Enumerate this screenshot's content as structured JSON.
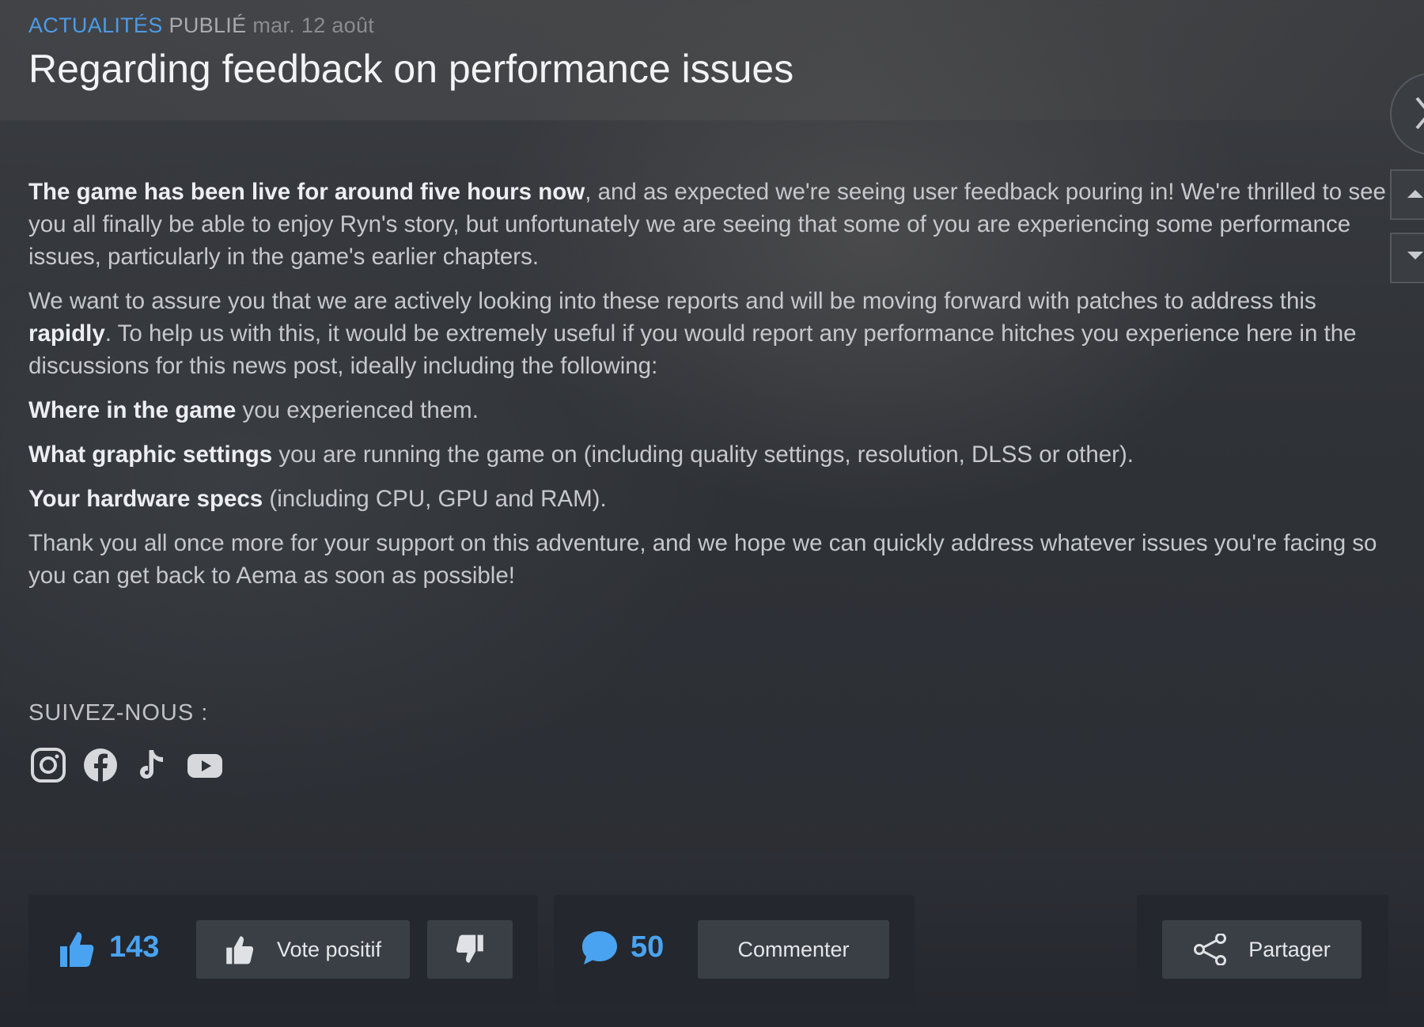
{
  "header": {
    "category": "ACTUALITÉS",
    "published_label": "PUBLIÉ",
    "date": "mar. 12 août",
    "title": "Regarding feedback on performance issues"
  },
  "article": {
    "p1_bold": "The game has been live for around five hours now",
    "p1_rest": ", and as expected we're seeing user feedback pouring in! We're thrilled to see you all finally be able to enjoy Ryn's story, but unfortunately we are seeing that some of you are experiencing some performance issues, particularly in the game's earlier chapters.",
    "p2_start": "We want to assure you that we are actively looking into these reports and will be moving forward with patches to address this ",
    "p2_bold": "rapidly",
    "p2_rest": ". To help us with this, it would be extremely useful if you would report any performance hitches you experience here in the discussions for this news post, ideally including the following:",
    "p3_bold": "Where in the game",
    "p3_rest": " you experienced them.",
    "p4_bold": "What graphic settings",
    "p4_rest": " you are running the game on (including quality settings, resolution, DLSS or other).",
    "p5_bold": "Your hardware specs",
    "p5_rest": " (including CPU, GPU and RAM).",
    "p6": "Thank you all once more for your support on this adventure, and we hope we can quickly address whatever issues you're facing so you can get back to Aema as soon as possible!"
  },
  "follow": {
    "label": "SUIVEZ-NOUS :",
    "icons": [
      "instagram-icon",
      "facebook-icon",
      "tiktok-icon",
      "youtube-icon"
    ]
  },
  "footer": {
    "votes_count": "143",
    "vote_up_label": "Vote positif",
    "comments_count": "50",
    "comment_label": "Commenter",
    "share_label": "Partager"
  },
  "colors": {
    "accent": "#4c9be8",
    "count_blue": "#4aa3f0",
    "button_bg": "#3a3e45",
    "panel_bg": "#24272d"
  }
}
